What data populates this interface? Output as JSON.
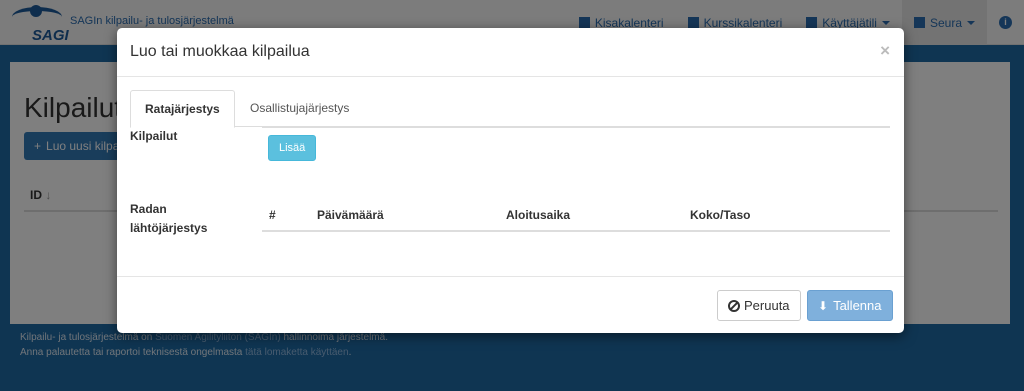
{
  "nav": {
    "logo_text": "SAGI",
    "brand_title": "SAGIn kilpailu- ja tulosjärjestelmä",
    "items": [
      {
        "label": "Kisakalenteri",
        "icon": "calendar-icon"
      },
      {
        "label": "Kurssikalenteri",
        "icon": "list-icon"
      },
      {
        "label": "Käyttäjätili",
        "icon": "folder-icon"
      },
      {
        "label": "Seura",
        "icon": "list-icon"
      }
    ],
    "info_icon": "info-icon"
  },
  "background_page": {
    "title": "Kilpailut",
    "new_button": "Luo uusi kilpailu",
    "table_header_id": "ID"
  },
  "footer": {
    "line1_prefix": "Kilpailu- ja tulosjärjestelmä on ",
    "line1_link": "Suomen Agilityliiton (SAGIn)",
    "line1_suffix": " hallinnoima järjestelmä.",
    "line2_prefix": "Anna palautetta tai raportoi teknisestä ongelmasta ",
    "line2_link": "tätä lomaketta käyttäen",
    "line2_suffix": "."
  },
  "modal": {
    "title": "Luo tai muokkaa kilpailua",
    "close": "×",
    "tabs": [
      {
        "label": "Ratajärjestys",
        "active": true
      },
      {
        "label": "Osallistujajärjestys",
        "active": false
      }
    ],
    "competitions_label": "Kilpailut",
    "add_button": "Lisää",
    "order_label": "Radan lähtöjärjestys",
    "table_headers": [
      "#",
      "Päivämäärä",
      "Aloitusaika",
      "Koko/Taso"
    ],
    "cancel_button": "Peruuta",
    "save_button": "Tallenna"
  },
  "colors": {
    "primary": "#337ab7",
    "info": "#5bc0de",
    "footer_bg": "#1f6aa5"
  }
}
